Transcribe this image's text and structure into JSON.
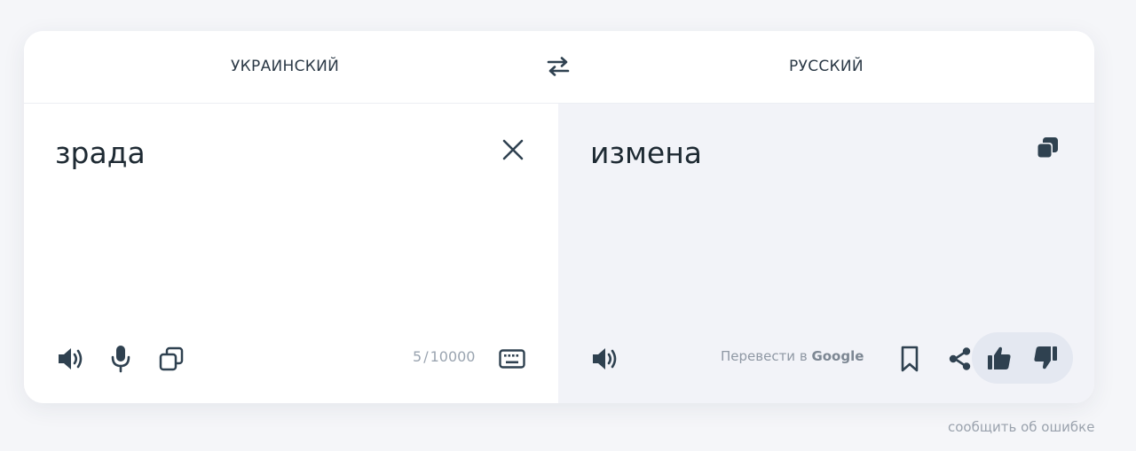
{
  "languages": {
    "source": "УКРАИНСКИЙ",
    "target": "РУССКИЙ"
  },
  "source": {
    "text": "зрада",
    "counter_current": "5",
    "counter_max": "10000"
  },
  "target": {
    "text": "измена",
    "google_prefix": "Перевести в ",
    "google_brand": "Google"
  },
  "footer": {
    "report_link": "сообщить об ошибке"
  },
  "colors": {
    "icon": "#2f4150",
    "card": "#ffffff",
    "target_pane": "#f2f3f8",
    "rating_pill": "#e4e8f1"
  }
}
